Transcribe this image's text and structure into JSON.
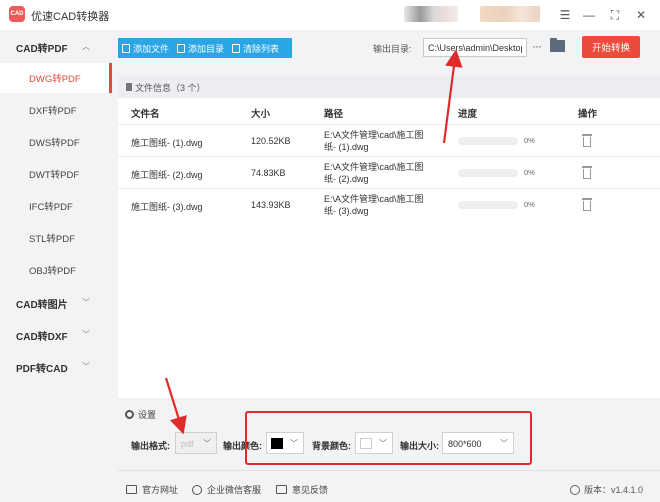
{
  "app": {
    "title": "优速CAD转换器",
    "logo_text": "CAD"
  },
  "sidebar": {
    "groups": [
      {
        "label": "CAD转PDF",
        "expanded": true,
        "items": [
          "DWG转PDF",
          "DXF转PDF",
          "DWS转PDF",
          "DWT转PDF",
          "IFC转PDF",
          "STL转PDF",
          "OBJ转PDF"
        ]
      },
      {
        "label": "CAD转图片",
        "expanded": false
      },
      {
        "label": "CAD转DXF",
        "expanded": false
      },
      {
        "label": "PDF转CAD",
        "expanded": false
      }
    ],
    "active_item": "DWG转PDF"
  },
  "toolbar": {
    "add_file": "添加文件",
    "add_folder": "添加目录",
    "clear_list": "清除列表",
    "output_dir_label": "输出目录:",
    "output_dir_value": "C:\\Users\\admin\\Desktop",
    "more": "···",
    "start": "开始转换"
  },
  "file_list": {
    "header": "文件信息（3 个）",
    "columns": {
      "name": "文件名",
      "size": "大小",
      "path": "路径",
      "progress": "进度",
      "action": "操作"
    },
    "rows": [
      {
        "name": "施工图纸- (1).dwg",
        "size": "120.52KB",
        "path_line1": "E:\\A文件管理\\cad\\施工图",
        "path_line2": "纸- (1).dwg",
        "percent": "0%"
      },
      {
        "name": "施工图纸- (2).dwg",
        "size": "74.83KB",
        "path_line1": "E:\\A文件管理\\cad\\施工图",
        "path_line2": "纸- (2).dwg",
        "percent": "0%"
      },
      {
        "name": "施工图纸- (3).dwg",
        "size": "143.93KB",
        "path_line1": "E:\\A文件管理\\cad\\施工图",
        "path_line2": "纸- (3).dwg",
        "percent": "0%"
      }
    ]
  },
  "settings": {
    "header": "设置",
    "format_label": "输出格式:",
    "format_value": "pdf",
    "color_label": "输出颜色:",
    "color_value": "#000000",
    "bg_label": "背景颜色:",
    "bg_value": "#ffffff",
    "size_label": "输出大小:",
    "size_value": "800*600"
  },
  "footer": {
    "website": "官方网址",
    "wechat": "企业微信客服",
    "feedback": "意见反馈",
    "version": "版本：v1.4.1.0"
  },
  "colors": {
    "accent": "#ea4b3c",
    "toolbar_blue": "#2aa6e7",
    "annotation_red": "#e02b2b"
  }
}
